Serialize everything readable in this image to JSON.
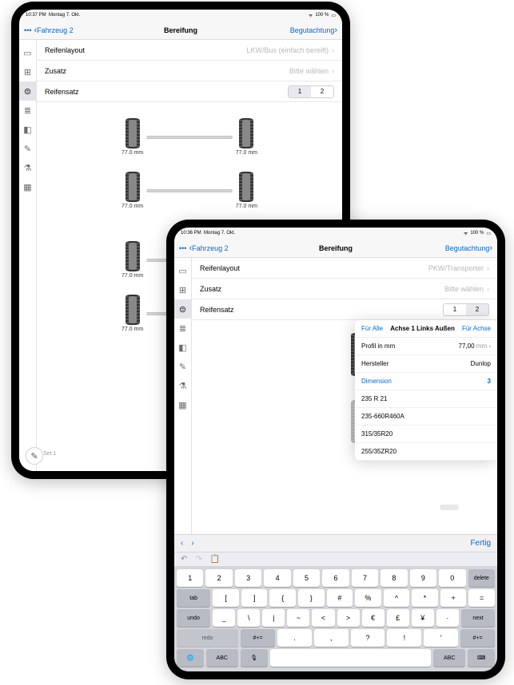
{
  "status": {
    "time1": "10:37 PM",
    "time2": "10:36 PM",
    "date": "Montag 7. Okt.",
    "battery": "100 %"
  },
  "nav": {
    "more": "•••",
    "back": "Fahrzeug 2",
    "title": "Bereifung",
    "forward": "Begutachtung"
  },
  "form": {
    "layout_label": "Reifenlayout",
    "layout_val1": "LKW/Bus (einfach bereift)",
    "layout_val2": "PKW/Transporter",
    "zusatz_label": "Zusatz",
    "zusatz_val": "Bitte wählen",
    "reifensatz_label": "Reifensatz",
    "seg1": "1",
    "seg2": "2"
  },
  "tire_mm": "77.0 mm",
  "set1": "Set 1",
  "popover": {
    "left": "Für Alle",
    "title": "Achse 1 Links Außen",
    "right": "Für Achse",
    "profil_label": "Profil in mm",
    "profil_val": "77,00",
    "profil_unit": "mm",
    "hersteller_label": "Hersteller",
    "hersteller_val": "Dunlop",
    "dimension_label": "Dimension",
    "dimension_val": "3",
    "options": [
      "235 R 21",
      "235-660R460A",
      "315/35R20",
      "255/35ZR20"
    ]
  },
  "kbbar": {
    "fertig": "Fertig"
  },
  "keys": {
    "nums": [
      "1",
      "2",
      "3",
      "4",
      "5",
      "6",
      "7",
      "8",
      "9",
      "0"
    ],
    "r2": [
      "[",
      "]",
      "{",
      "}",
      "#",
      "%",
      "^",
      "*",
      "+",
      "="
    ],
    "r3": [
      "_",
      "\\",
      "|",
      "~",
      "<",
      ">",
      "€",
      "£",
      "¥",
      "·"
    ],
    "delete": "delete",
    "tab": "tab",
    "undo": "undo",
    "next": "next",
    "redo": "redo",
    "sym": "#+=",
    "abc": "ABC",
    "mic": "🎤",
    "globe": "🌐",
    "kb": "⌨"
  }
}
